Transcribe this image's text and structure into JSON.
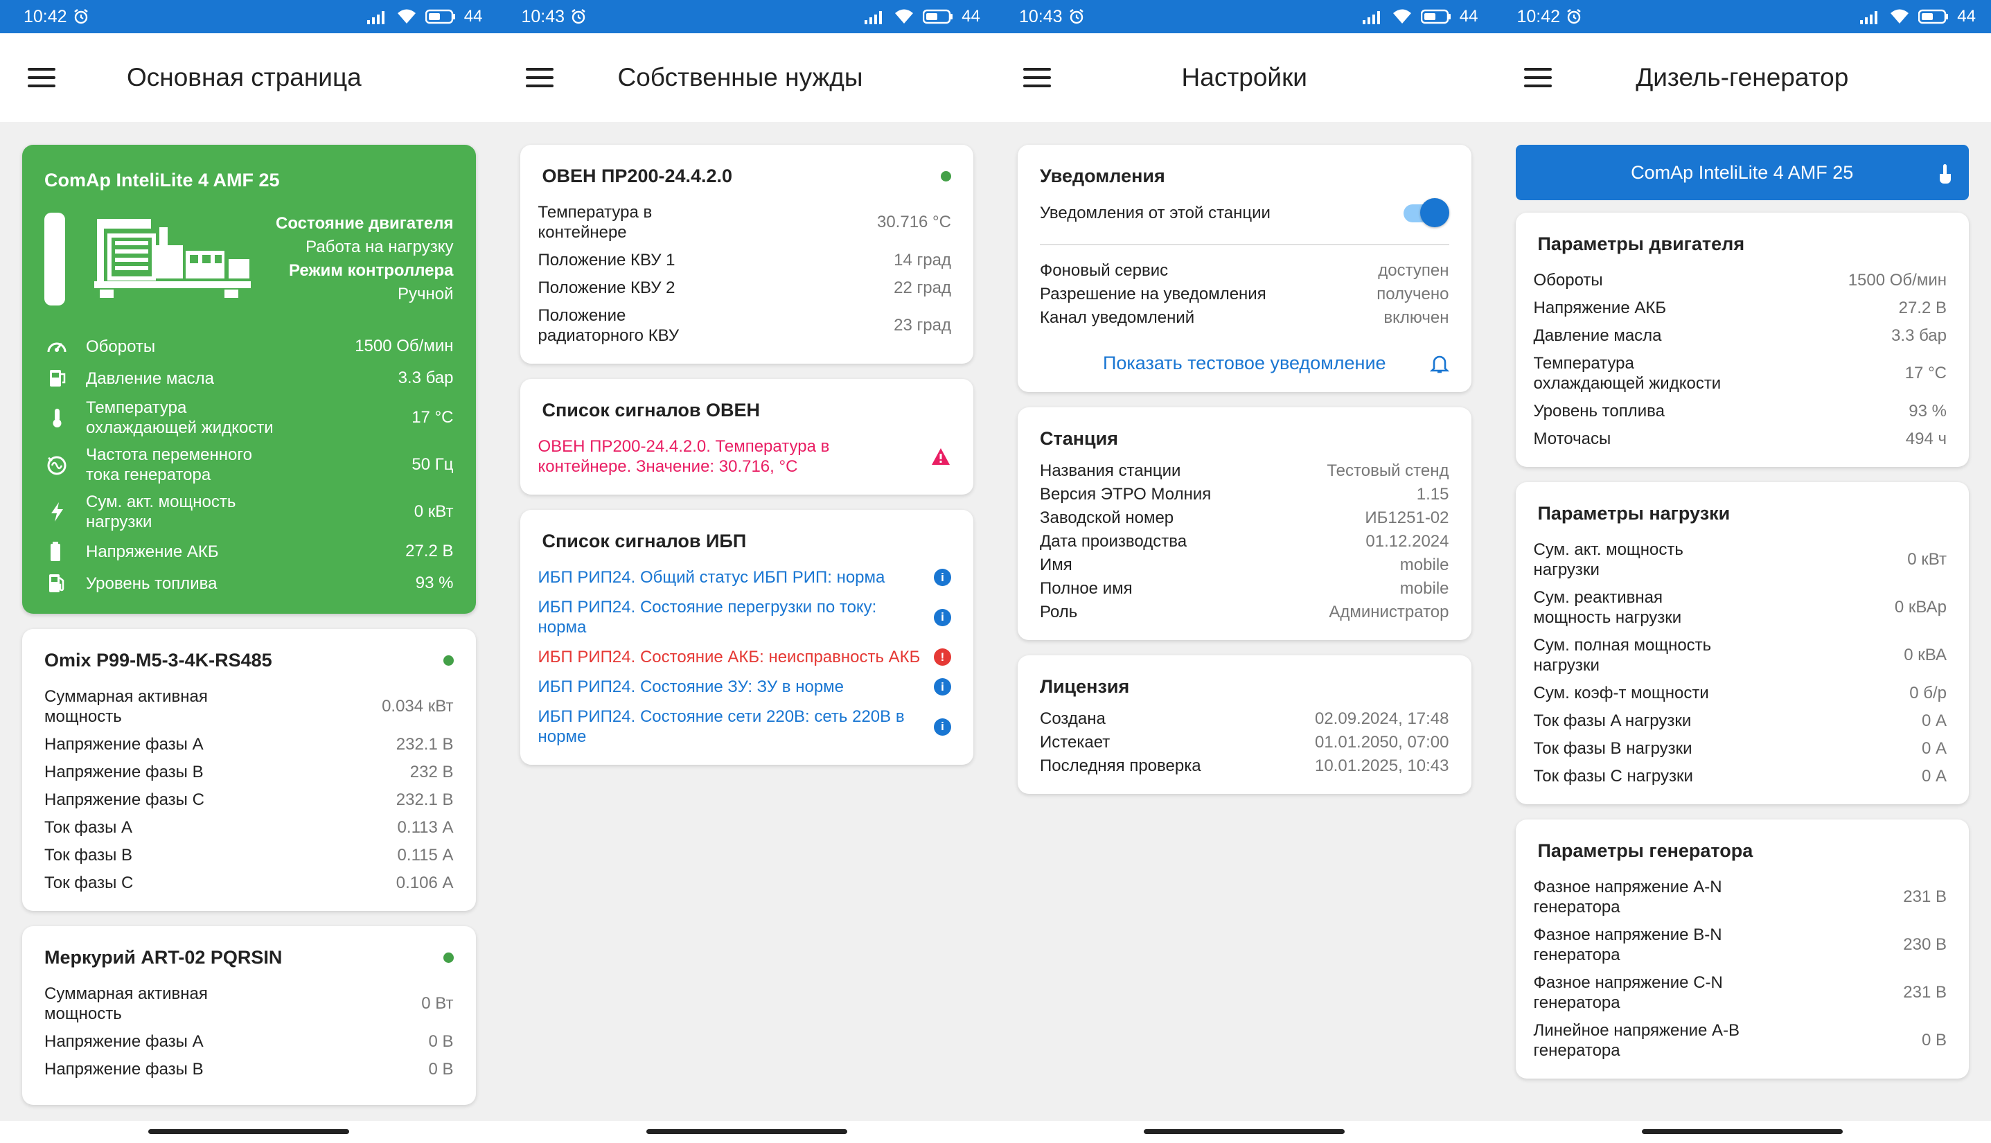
{
  "panels": [
    {
      "status": {
        "time": "10:42",
        "battery": "44"
      },
      "title": "Основная страница",
      "green_card": {
        "title": "ComAp InteliLite 4 AMF 25",
        "engine_state_label": "Состояние двигателя",
        "engine_state_value": "Работа на нагрузку",
        "controller_mode_label": "Режим контроллера",
        "controller_mode_value": "Ручной",
        "metrics": [
          {
            "icon": "speedometer-icon",
            "label": "Обороты",
            "value": "1500 Об/мин"
          },
          {
            "icon": "oil-can-icon",
            "label": "Давление масла",
            "value": "3.3 бар"
          },
          {
            "icon": "thermometer-icon",
            "label": "Температура охлаждающей жидкости",
            "value": "17 °C"
          },
          {
            "icon": "frequency-icon",
            "label": "Частота переменного тока генератора",
            "value": "50 Гц"
          },
          {
            "icon": "lightning-icon",
            "label": "Сум. акт. мощность нагрузки",
            "value": "0 кВт"
          },
          {
            "icon": "battery-icon",
            "label": "Напряжение АКБ",
            "value": "27.2 В"
          },
          {
            "icon": "fuel-pump-icon",
            "label": "Уровень топлива",
            "value": "93 %"
          }
        ]
      },
      "cards": [
        {
          "title": "Omix P99-M5-3-4K-RS485",
          "online": true,
          "rows": [
            {
              "label": "Суммарная активная мощность",
              "value": "0.034 кВт"
            },
            {
              "label": "Напряжение фазы A",
              "value": "232.1 В"
            },
            {
              "label": "Напряжение фазы B",
              "value": "232 В"
            },
            {
              "label": "Напряжение фазы C",
              "value": "232.1 В"
            },
            {
              "label": "Ток фазы A",
              "value": "0.113 А"
            },
            {
              "label": "Ток фазы B",
              "value": "0.115 А"
            },
            {
              "label": "Ток фазы C",
              "value": "0.106 А"
            }
          ]
        },
        {
          "title": "Меркурий ART-02 PQRSIN",
          "online": true,
          "rows": [
            {
              "label": "Суммарная активная мощность",
              "value": "0 Вт"
            },
            {
              "label": "Напряжение фазы A",
              "value": "0 В"
            },
            {
              "label": "Напряжение фазы B",
              "value": "0 В"
            }
          ]
        }
      ]
    },
    {
      "status": {
        "time": "10:43",
        "battery": "44"
      },
      "title": "Собственные нужды",
      "oven_card": {
        "title": "ОВЕН ПР200-24.4.2.0",
        "online": true,
        "rows": [
          {
            "label": "Температура в контейнере",
            "value": "30.716 °C"
          },
          {
            "label": "Положение КВУ 1",
            "value": "14 град"
          },
          {
            "label": "Положение КВУ 2",
            "value": "22 град"
          },
          {
            "label": "Положение радиаторного КВУ",
            "value": "23 град"
          }
        ]
      },
      "oven_signals": {
        "title": "Список сигналов ОВЕН",
        "items": [
          {
            "text": "ОВЕН ПР200-24.4.2.0. Температура в контейнере. Значение: 30.716, °C",
            "level": "warning"
          }
        ]
      },
      "ups_signals": {
        "title": "Список сигналов ИБП",
        "items": [
          {
            "text": "ИБП РИП24. Общий статус ИБП РИП: норма",
            "level": "info"
          },
          {
            "text": "ИБП РИП24. Состояние перегрузки по току: норма",
            "level": "info"
          },
          {
            "text": "ИБП РИП24. Состояние АКБ: неисправность АКБ",
            "level": "error"
          },
          {
            "text": "ИБП РИП24. Состояние ЗУ: ЗУ в норме",
            "level": "info"
          },
          {
            "text": "ИБП РИП24. Состояние сети 220В: сеть 220В в норме",
            "level": "info"
          }
        ],
        "info_glyph": "i",
        "error_glyph": "!"
      }
    },
    {
      "status": {
        "time": "10:43",
        "battery": "44"
      },
      "title": "Настройки",
      "notifications": {
        "title": "Уведомления",
        "toggle_label": "Уведомления от этой станции",
        "toggle_on": true,
        "rows": [
          {
            "label": "Фоновый сервис",
            "value": "доступен"
          },
          {
            "label": "Разрешение на уведомления",
            "value": "получено"
          },
          {
            "label": "Канал уведомлений",
            "value": "включен"
          }
        ],
        "test_link": "Показать тестовое уведомление"
      },
      "station": {
        "title": "Станция",
        "rows": [
          {
            "label": "Названия станции",
            "value": "Тестовый стенд"
          },
          {
            "label": "Версия ЭТРО Молния",
            "value": "1.15"
          },
          {
            "label": "Заводской номер",
            "value": "ИБ1251-02"
          },
          {
            "label": "Дата производства",
            "value": "01.12.2024"
          },
          {
            "label": "Имя",
            "value": "mobile"
          },
          {
            "label": "Полное имя",
            "value": "mobile"
          },
          {
            "label": "Роль",
            "value": "Администратор"
          }
        ]
      },
      "license": {
        "title": "Лицензия",
        "rows": [
          {
            "label": "Создана",
            "value": "02.09.2024, 17:48"
          },
          {
            "label": "Истекает",
            "value": "01.01.2050, 07:00"
          },
          {
            "label": "Последняя проверка",
            "value": "10.01.2025, 10:43"
          }
        ]
      }
    },
    {
      "status": {
        "time": "10:42",
        "battery": "44"
      },
      "title": "Дизель-генератор",
      "device_button": "ComAp InteliLite 4 AMF 25",
      "engine_params": {
        "title": "Параметры двигателя",
        "rows": [
          {
            "label": "Обороты",
            "value": "1500 Об/мин"
          },
          {
            "label": "Напряжение АКБ",
            "value": "27.2 В"
          },
          {
            "label": "Давление масла",
            "value": "3.3 бар"
          },
          {
            "label": "Температура охлаждающей жидкости",
            "value": "17 °C"
          },
          {
            "label": "Уровень топлива",
            "value": "93 %"
          },
          {
            "label": "Моточасы",
            "value": "494 ч"
          }
        ]
      },
      "load_params": {
        "title": "Параметры нагрузки",
        "rows": [
          {
            "label": "Сум. акт. мощность нагрузки",
            "value": "0 кВт"
          },
          {
            "label": "Сум. реактивная мощность нагрузки",
            "value": "0 кВАр"
          },
          {
            "label": "Сум. полная мощность нагрузки",
            "value": "0 кВА"
          },
          {
            "label": "Сум. коэф-т мощности",
            "value": "0 б/р"
          },
          {
            "label": "Ток фазы A нагрузки",
            "value": "0 А"
          },
          {
            "label": "Ток фазы B нагрузки",
            "value": "0 А"
          },
          {
            "label": "Ток фазы C нагрузки",
            "value": "0 А"
          }
        ]
      },
      "generator_params": {
        "title": "Параметры генератора",
        "rows": [
          {
            "label": "Фазное напряжение A-N генератора",
            "value": "231 В"
          },
          {
            "label": "Фазное напряжение B-N генератора",
            "value": "230 В"
          },
          {
            "label": "Фазное напряжение C-N генератора",
            "value": "231 В"
          },
          {
            "label": "Линейное напряжение A-B генератора",
            "value": "0 В"
          }
        ]
      }
    }
  ]
}
